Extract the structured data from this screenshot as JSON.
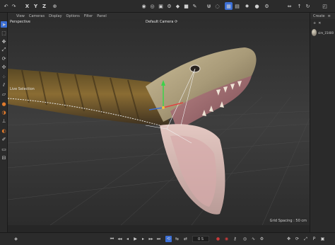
{
  "topbar": {
    "axis_x": "X",
    "axis_y": "Y",
    "axis_z": "Z"
  },
  "viewport_menu": {
    "view": "View",
    "cameras": "Cameras",
    "display": "Display",
    "options": "Options",
    "filter": "Filter",
    "panel": "Panel"
  },
  "viewport": {
    "projection": "Perspective",
    "camera": "Default Camera ⟳",
    "grid_spacing": "Grid Spacing : 50 cm",
    "selection_label": "Live Selection"
  },
  "right_panel": {
    "create_label": "Create",
    "object_name": "sim_15400"
  },
  "timeline": {
    "frame_value": "0 S"
  },
  "colors": {
    "accent_blue": "#3b6fd6",
    "record_red": "#c93a3a"
  }
}
